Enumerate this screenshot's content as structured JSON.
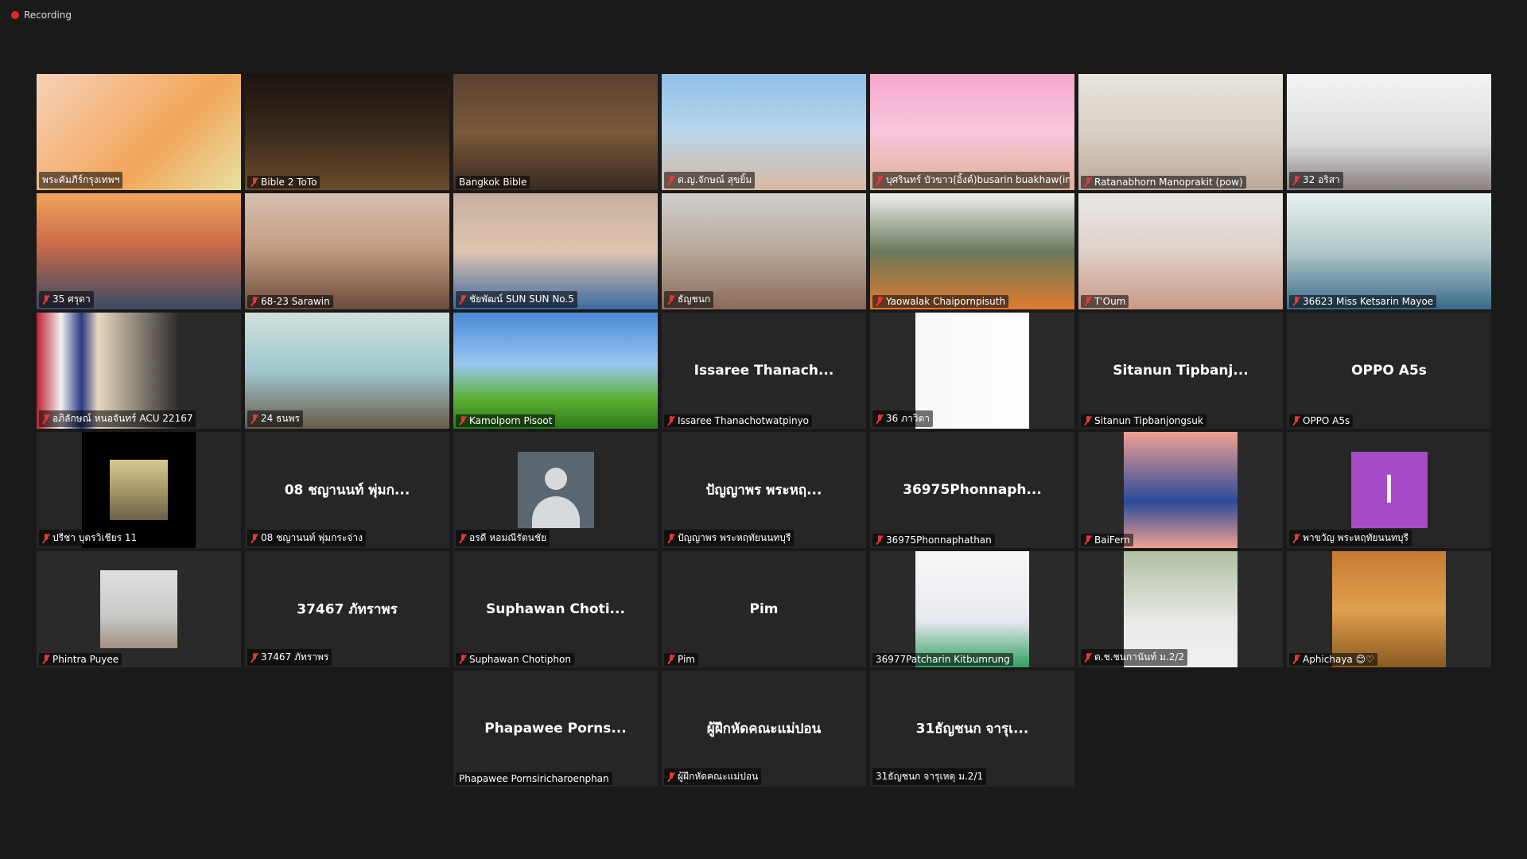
{
  "recording": {
    "label": "Recording"
  },
  "tiles": [
    {
      "label": "พระคัมภีร์กรุงเทพฯ",
      "muted": false,
      "type": "video",
      "bg": "linear-gradient(135deg,#f7d1b8,#f2a65a 60%,#e8e0a0)"
    },
    {
      "label": "Bible 2 ToTo",
      "muted": true,
      "type": "video",
      "bg": "linear-gradient(180deg,#1b1410,#3a2a1c 50%,#6b4a2a)"
    },
    {
      "label": "Bangkok Bible",
      "muted": false,
      "type": "video",
      "active": true,
      "bg": "linear-gradient(180deg,#5a4030,#7a5a3a 50%,#3a2a20)"
    },
    {
      "label": "ด.ญ.จักษณ์ สุขยิ้ม",
      "muted": true,
      "type": "video",
      "bg": "linear-gradient(180deg,#8fc0e8,#b9d6ec 50%,#d9b9a0)"
    },
    {
      "label": "บุศรินทร์ บัวขาว(อิ้งค์)busarin buakhaw(in...",
      "muted": true,
      "type": "video",
      "bg": "linear-gradient(180deg,#f4a8cc,#f8c6dc 50%,#e0b090)"
    },
    {
      "label": "Ratanabhorn Manoprakit (pow)",
      "muted": true,
      "type": "video",
      "bg": "linear-gradient(180deg,#e8e4dc,#d8d0c4 50%,#bca898)"
    },
    {
      "label": "32 อริสา",
      "muted": true,
      "type": "video",
      "bg": "linear-gradient(180deg,#f4f4f4,#dadada 60%,#8a8080)"
    },
    {
      "label": "35 ศรุดา",
      "muted": true,
      "type": "video",
      "bg": "linear-gradient(180deg,#f2a55c,#c86a48 45%,#3a4a66)"
    },
    {
      "label": "68-23 Sarawin",
      "muted": true,
      "type": "video",
      "bg": "linear-gradient(180deg,#d8c0b0,#c09a80 50%,#6a4a3a)"
    },
    {
      "label": "ชัยพัฒน์ SUN SUN No.5",
      "muted": true,
      "type": "video",
      "bg": "linear-gradient(180deg,#c8b0a0,#e0c4b0 50%,#3a6aa0)"
    },
    {
      "label": "ธัญชนก",
      "muted": true,
      "type": "video",
      "bg": "linear-gradient(180deg,#d0d0d0,#b8a898 50%,#8a6a5a)"
    },
    {
      "label": "Yaowalak Chaipornpisuth",
      "muted": true,
      "type": "video",
      "bg": "linear-gradient(180deg,#f0f0f0,#6a7a5a 50%,#e07a30)"
    },
    {
      "label": "T'Oum",
      "muted": true,
      "type": "video",
      "bg": "linear-gradient(180deg,#e8e8e8,#e0d0c8 50%,#c89a88)"
    },
    {
      "label": "36623 Miss Ketsarin Mayoe",
      "muted": true,
      "type": "video",
      "bg": "linear-gradient(180deg,#e8f0f0,#b0c8c8 50%,#3a6a8a)"
    },
    {
      "label": "อภิลักษณ์ หนอจันทร์ ACU 22167",
      "muted": true,
      "type": "video",
      "bg": "linear-gradient(90deg,#c02030 0,#f0f0f0 12%,#2a3a80 22%,#e8d8c0 30%,#2a2a2a 70%)"
    },
    {
      "label": "24 ธนพร",
      "muted": true,
      "type": "video",
      "bg": "linear-gradient(180deg,#d0e0d8,#a0c8d0 50%,#6a5a4a)"
    },
    {
      "label": "Kamolporn Pisoot",
      "muted": true,
      "type": "video",
      "bg": "linear-gradient(180deg,#4a8ad8,#9ac8f0 45%,#5ab030 75%,#2a7a1a)"
    },
    {
      "label": "Issaree Thanachotwatpinyo",
      "muted": true,
      "type": "name",
      "name": "Issaree  Thanach..."
    },
    {
      "label": "36 ภาวิตา",
      "muted": true,
      "type": "video",
      "bg": "linear-gradient(90deg,#f8f8f8,#ffffff)",
      "narrow": true
    },
    {
      "label": "Sitanun Tipbanjongsuk",
      "muted": true,
      "type": "name",
      "name": "Sitanun  Tipbanj..."
    },
    {
      "label": "OPPO A5s",
      "muted": true,
      "type": "name",
      "name": "OPPO A5s"
    },
    {
      "label": "ปรีชา บุตรวิเชียร  11",
      "muted": true,
      "type": "video",
      "bg": "linear-gradient(180deg,#d8c890,#a89868 50%,#6a6048)",
      "narrow": true,
      "blackframe": true
    },
    {
      "label": "08 ชญานนท์ พุ่มกระจ่าง",
      "muted": true,
      "type": "name",
      "name": "08 ชญานนท์ พุ่มก..."
    },
    {
      "label": "อรดี หอมณีรัตนชัย",
      "muted": true,
      "type": "avatar"
    },
    {
      "label": "ปัญญาพร พระหฤทัยนนทบุรี",
      "muted": true,
      "type": "name",
      "name": "ปัญญาพร  พระหฤ..."
    },
    {
      "label": "36975Phonnaphathan",
      "muted": true,
      "type": "name",
      "name": "36975Phonnaph..."
    },
    {
      "label": "BaiFern",
      "muted": true,
      "type": "video",
      "bg": "linear-gradient(180deg,#f0a090,#2a4a9a 60%,#f0a090)",
      "narrow": true
    },
    {
      "label": "พาขวัญ พระหฤทัยนนทบุรี",
      "muted": true,
      "type": "letter",
      "letter": "I"
    },
    {
      "label": "Phintra Puyee",
      "muted": true,
      "type": "video",
      "bg": "linear-gradient(180deg,#e0e0e0,#c8c8c8 60%,#a09080)",
      "small": true
    },
    {
      "label": "37467 ภัทราพร",
      "muted": true,
      "type": "name",
      "name": "37467 ภัทราพร"
    },
    {
      "label": "Suphawan Chotiphon",
      "muted": true,
      "type": "name",
      "name": "Suphawan  Choti..."
    },
    {
      "label": "Pim",
      "muted": true,
      "type": "name",
      "name": "Pim"
    },
    {
      "label": "36977Patcharin Kitbumrung",
      "muted": false,
      "type": "video",
      "bg": "linear-gradient(180deg,#f8f8f8,#e8e8f0 60%,#30a060)",
      "narrow": true
    },
    {
      "label": "ด.ช.ชนกานันท์ ม.2/2",
      "muted": true,
      "type": "video",
      "bg": "linear-gradient(180deg,#b0c0a0,#e8e8e8 60%,#f0f0f0)",
      "narrow": true
    },
    {
      "label": "Aphichaya 😊♡",
      "muted": true,
      "type": "video",
      "bg": "linear-gradient(180deg,#c87a30,#e0a050 50%,#8a5a20)",
      "narrow": true
    },
    {
      "label": "Phapawee Pornsiricharoenphan",
      "muted": false,
      "type": "name",
      "name": "Phapawee  Porns..."
    },
    {
      "label": "ผู้ฝึกหัดคณะแม่ปอน",
      "muted": true,
      "type": "name",
      "name": "ผู้ฝึกหัดคณะแม่ปอน"
    },
    {
      "label": "31ธัญชนก    จารุเหตุ ม.2/1",
      "muted": false,
      "type": "name",
      "name": "31ธัญชนก    จารุเ..."
    }
  ]
}
